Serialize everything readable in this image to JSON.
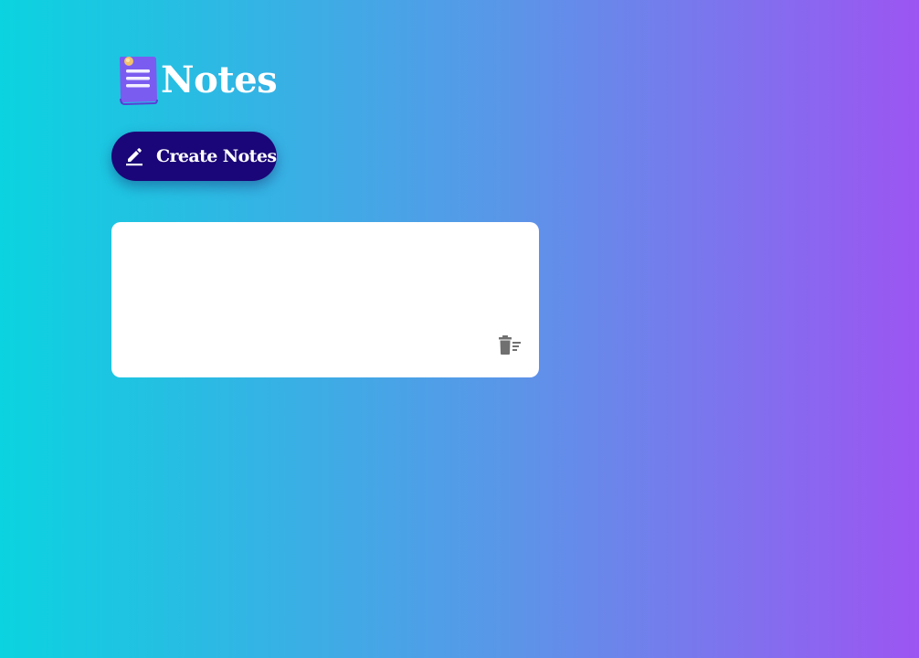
{
  "app": {
    "title": "Notes",
    "logo_icon": "notepad-icon"
  },
  "toolbar": {
    "create_label": "Create Notes",
    "create_icon": "pencil-icon"
  },
  "notes": [
    {
      "text": "",
      "delete_icon": "trash-icon"
    }
  ],
  "colors": {
    "background_start": "#0bd3e0",
    "background_end": "#9c55f2",
    "button_bg": "#1a0678",
    "card_bg": "#ffffff",
    "logo_purple": "#7b5cf0",
    "delete_icon": "#707070"
  }
}
